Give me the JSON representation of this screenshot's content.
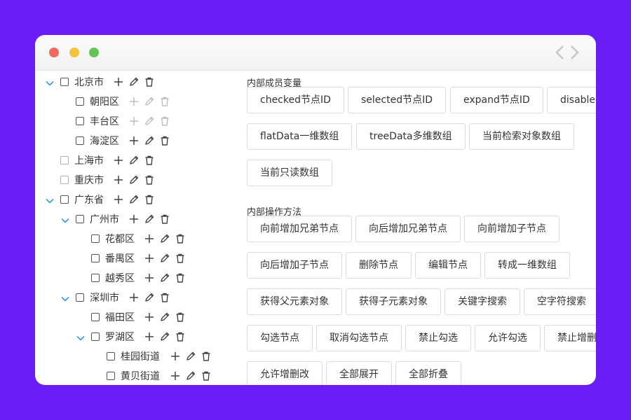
{
  "tree": [
    {
      "label": "北京市",
      "level": 0,
      "expanded": true,
      "has_children": true
    },
    {
      "label": "朝阳区",
      "level": 1,
      "disabled": true
    },
    {
      "label": "丰台区",
      "level": 1,
      "disabled": true
    },
    {
      "label": "海淀区",
      "level": 1
    },
    {
      "label": "上海市",
      "level": 0
    },
    {
      "label": "重庆市",
      "level": 0
    },
    {
      "label": "广东省",
      "level": 0,
      "expanded": true,
      "has_children": true
    },
    {
      "label": "广州市",
      "level": 1,
      "expanded": true,
      "has_children": true
    },
    {
      "label": "花都区",
      "level": 2
    },
    {
      "label": "番禺区",
      "level": 2
    },
    {
      "label": "越秀区",
      "level": 2
    },
    {
      "label": "深圳市",
      "level": 1,
      "expanded": true,
      "has_children": true
    },
    {
      "label": "福田区",
      "level": 2
    },
    {
      "label": "罗湖区",
      "level": 2,
      "expanded": true,
      "has_children": true
    },
    {
      "label": "桂园街道",
      "level": 3
    },
    {
      "label": "黄贝街道",
      "level": 3
    }
  ],
  "sections": [
    {
      "title": "内部成员变量",
      "rows": [
        [
          "checked节点ID",
          "selected节点ID",
          "expand节点ID",
          "disabled节点ID"
        ],
        [
          "flatData一维数组",
          "treeData多维数组",
          "当前检索对象数组"
        ],
        [
          "当前只读数组"
        ]
      ]
    },
    {
      "title": "内部操作方法",
      "rows": [
        [
          "向前增加兄弟节点",
          "向后增加兄弟节点",
          "向前增加子节点"
        ],
        [
          "向后增加子节点",
          "删除节点",
          "编辑节点",
          "转成一维数组"
        ],
        [
          "获得父元素对象",
          "获得子元素对象",
          "关键字搜索",
          "空字符搜索"
        ],
        [
          "勾选节点",
          "取消勾选节点",
          "禁止勾选",
          "允许勾选",
          "禁止增删改"
        ],
        [
          "允许增删改",
          "全部展开",
          "全部折叠"
        ]
      ]
    }
  ],
  "colors": {
    "background": "#6a1ef5",
    "caret": "#1f8ef1",
    "text": "#333333"
  }
}
